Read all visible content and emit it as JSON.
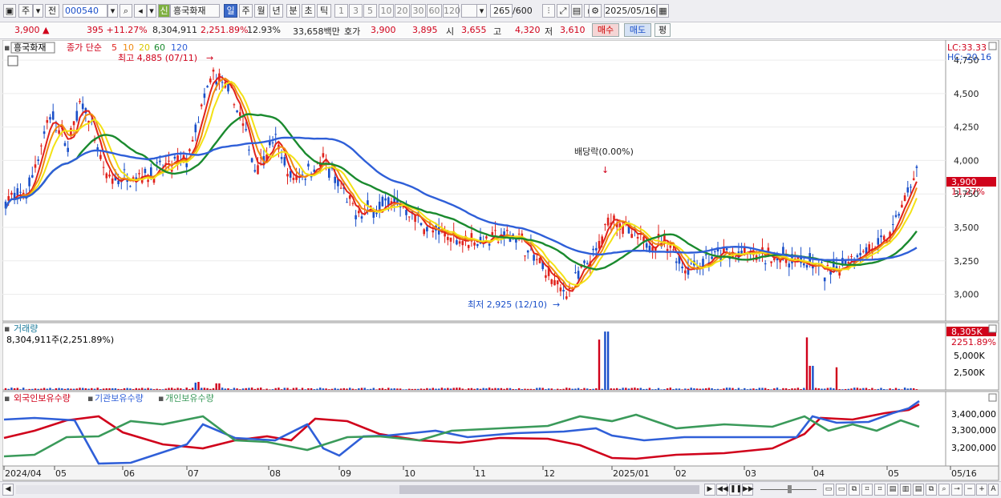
{
  "toolbar": {
    "market": "주",
    "prev": "전",
    "code": "000540",
    "badge": "신",
    "name": "흥국화재",
    "periods": [
      "일",
      "주",
      "월",
      "년",
      "분",
      "초",
      "틱"
    ],
    "nums": [
      "1",
      "3",
      "5",
      "10",
      "20",
      "30",
      "60",
      "120"
    ],
    "count": "265",
    "count_total": "/600",
    "date": "2025/05/16"
  },
  "quote": {
    "price": "3,900 ▲",
    "change": "395 +11.27%",
    "volume": "8,304,911",
    "vol_ratio": "2,251.89%",
    "turnover": "12.93%",
    "amount": "33,658백만",
    "ask_label": "호가",
    "ask": "3,900",
    "bid": "3,895",
    "open_label": "시",
    "open": "3,655",
    "high_label": "고",
    "high": "4,320",
    "low_label": "저",
    "low": "3,610",
    "buy": "매수",
    "sell": "매도",
    "avg": "평"
  },
  "price_panel": {
    "name_box": "흥국화재",
    "ma_label": "종가 단순",
    "ma_periods": [
      "5",
      "10",
      "20",
      "60",
      "120"
    ],
    "ma_colors": [
      "#e0221c",
      "#f08a10",
      "#f3e214",
      "#1a8a2e",
      "#2f5fd8"
    ],
    "high_note": "최고 4,885 (07/11)",
    "low_note": "최저 2,925 (12/10)",
    "div_note": "배당락(0.00%)",
    "lc": "LC:33.33",
    "hc": "HC:-20.16",
    "price_tag": "3,900",
    "pct_tag": "11.27%",
    "yticks": [
      "4,750",
      "4,500",
      "4,250",
      "4,000",
      "3,750",
      "3,500",
      "3,250",
      "3,000"
    ]
  },
  "volume_panel": {
    "title": "거래량",
    "value": "8,304,911주(2,251.89%)",
    "tag": "8,305K",
    "pct": "2251.89%",
    "yticks": [
      "5,000K",
      "2,500K"
    ]
  },
  "holder_panel": {
    "legends": [
      "외국인보유수량",
      "기관보유수량",
      "개인보유수량"
    ],
    "legend_colors": [
      "#d0021b",
      "#2f5fd8",
      "#3a9a5a"
    ],
    "yticks": [
      "3,400,000",
      "3,300,000",
      "3,200,000"
    ]
  },
  "xaxis": [
    "2024/04",
    "05",
    "06",
    "07",
    "08",
    "09",
    "10",
    "11",
    "12",
    "2025/01",
    "02",
    "03",
    "04",
    "05",
    "05/16"
  ]
}
